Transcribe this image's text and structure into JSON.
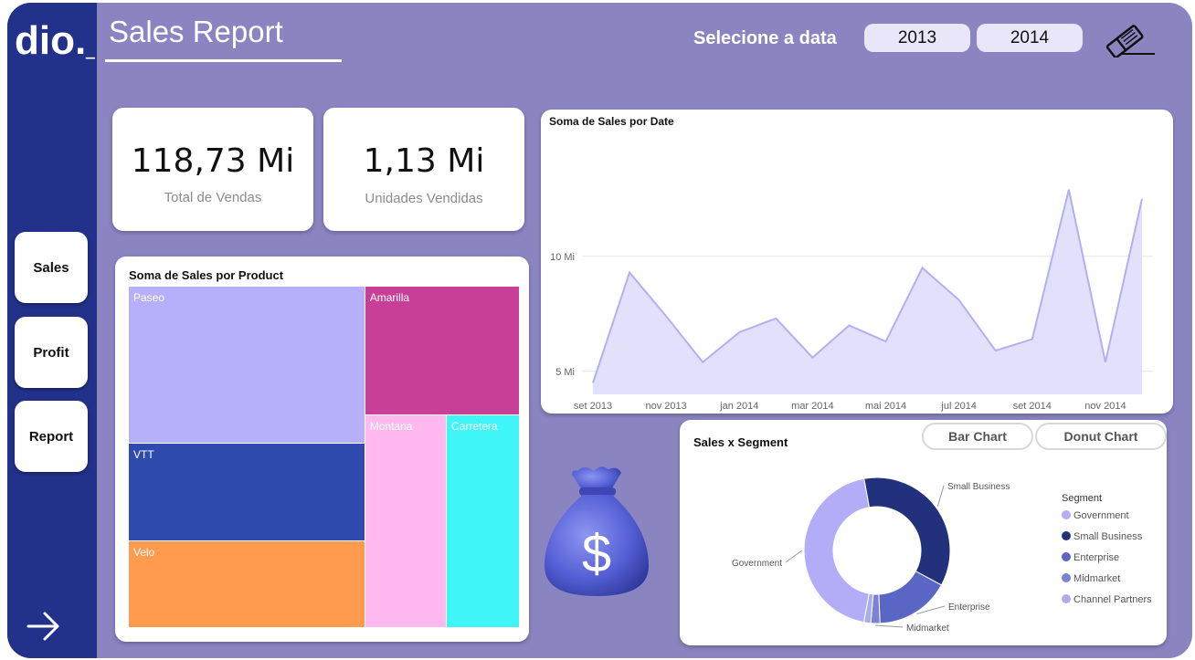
{
  "header": {
    "title": "Sales Report",
    "date_label": "Selecione a data",
    "years": [
      "2013",
      "2014"
    ]
  },
  "logo": {
    "text": "dio._"
  },
  "sidebar": {
    "items": [
      {
        "label": "Sales"
      },
      {
        "label": "Profit"
      },
      {
        "label": "Report"
      }
    ]
  },
  "kpis": [
    {
      "value": "118,73 Mi",
      "label": "Total de Vendas"
    },
    {
      "value": "1,13 Mi",
      "label": "Unidades Vendidas"
    }
  ],
  "icons": {
    "logo": "dio-logo",
    "clear_filters": "eraser-icon",
    "next_page": "arrow-right-icon",
    "money_bag": "money-bag-icon"
  },
  "colors": {
    "background": "#8a84c1",
    "sidebar": "#22318a",
    "line_fill": "#e3e0fb",
    "line_stroke": "#b4aef2"
  },
  "segment_tabs": [
    "Bar Chart",
    "Donut Chart"
  ],
  "chart_data": [
    {
      "type": "treemap",
      "title": "Soma de  Sales por Product",
      "categories": [
        "Paseo",
        "VTT",
        "Velo",
        "Amarilla",
        "Montana",
        "Carretera"
      ],
      "values": [
        33.0,
        20.5,
        18.2,
        17.7,
        15.4,
        13.8
      ],
      "colors": [
        "#b6b0fb",
        "#2e4aad",
        "#ff9a4f",
        "#c83f97",
        "#ffb9ef",
        "#40f5f7"
      ]
    },
    {
      "type": "area",
      "title": "Soma de  Sales por Date",
      "x_tick_labels": [
        "set 2013",
        "nov 2013",
        "jan 2014",
        "mar 2014",
        "mai 2014",
        "jul 2014",
        "set 2014",
        "nov 2014"
      ],
      "y_tick_labels": [
        "5 Mi",
        "10 Mi"
      ],
      "x": [
        "set 2013",
        "out 2013",
        "nov 2013",
        "dez 2013",
        "jan 2014",
        "fev 2014",
        "mar 2014",
        "abr 2014",
        "mai 2014",
        "jun 2014",
        "jul 2014",
        "ago 2014",
        "set 2014",
        "out 2014",
        "nov 2014",
        "dez 2014"
      ],
      "values": [
        4.5,
        9.3,
        7.4,
        5.4,
        6.7,
        7.3,
        5.6,
        7.0,
        6.3,
        9.5,
        8.1,
        5.9,
        6.4,
        12.9,
        5.4,
        12.5
      ],
      "ylim": [
        4.0,
        14.0
      ],
      "grid": true
    },
    {
      "type": "pie",
      "style": "donut",
      "title": "Sales x Segment",
      "legend_title": "Segment",
      "categories": [
        "Government",
        "Small Business",
        "Enterprise",
        "Midmarket",
        "Channel Partners"
      ],
      "values": [
        52.5,
        42.4,
        19.6,
        2.4,
        1.8
      ],
      "colors": [
        "#b3adf8",
        "#22317c",
        "#5a66c4",
        "#7b82cf",
        "#aaaee6"
      ],
      "annotations": [
        "Small Business",
        "Government",
        "Enterprise",
        "Midmarket"
      ],
      "legend_position": "right"
    }
  ]
}
